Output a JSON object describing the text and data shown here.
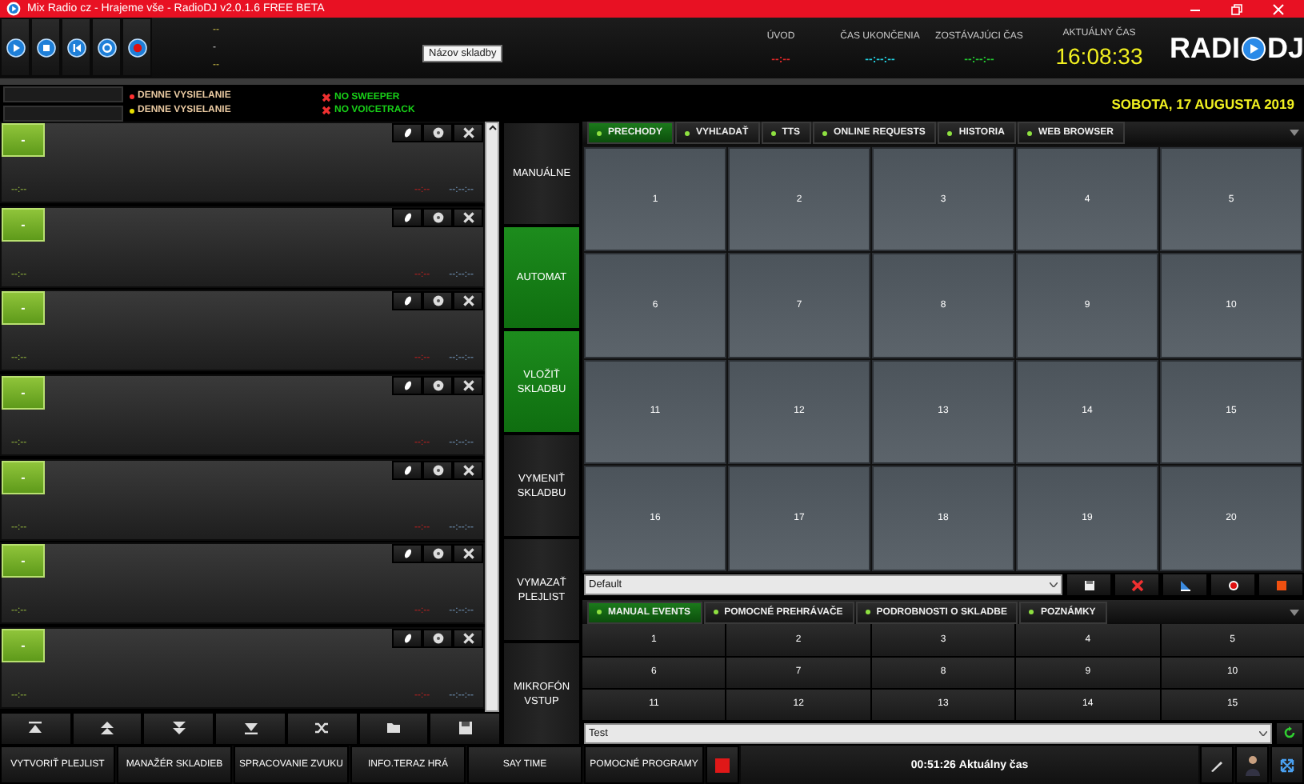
{
  "window": {
    "title": "Mix Radio cz - Hrajeme vše - RadioDJ v2.0.1.6 FREE BETA"
  },
  "header": {
    "track_lines": [
      "--",
      "-",
      "--"
    ],
    "tooltip": "Názov skladby",
    "timers": [
      {
        "label": "ÚVOD",
        "value": "--:--",
        "color": "#e02828"
      },
      {
        "label": "ČAS UKONČENIA",
        "value": "--:--:--",
        "color": "#22d0e0"
      },
      {
        "label": "ZOSTÁVAJÚCI ČAS",
        "value": "--:--:--",
        "color": "#22c830"
      }
    ],
    "clock_label": "AKTUÁLNY ČAS",
    "clock": "16:08:33",
    "logo": [
      "RADI",
      "DJ"
    ]
  },
  "status": {
    "schedules": [
      {
        "label": "DENNE VYSIELANIE",
        "color": "#ff3030"
      },
      {
        "label": "DENNE VYSIELANIE",
        "color": "#e8e000"
      }
    ],
    "warnings": [
      "NO SWEEPER",
      "NO VOICETRACK"
    ],
    "date": "SOBOTA, 17 AUGUSTA 2019"
  },
  "players": [
    {
      "button": "-",
      "elapsed": "--:--",
      "remaining": "--:--",
      "total": "--:--:--"
    },
    {
      "button": "-",
      "elapsed": "--:--",
      "remaining": "--:--",
      "total": "--:--:--"
    },
    {
      "button": "-",
      "elapsed": "--:--",
      "remaining": "--:--",
      "total": "--:--:--"
    },
    {
      "button": "-",
      "elapsed": "--:--",
      "remaining": "--:--",
      "total": "--:--:--"
    },
    {
      "button": "-",
      "elapsed": "--:--",
      "remaining": "--:--",
      "total": "--:--:--"
    },
    {
      "button": "-",
      "elapsed": "--:--",
      "remaining": "--:--",
      "total": "--:--:--"
    },
    {
      "button": "-",
      "elapsed": "--:--",
      "remaining": "--:--",
      "total": "--:--:--"
    }
  ],
  "modes": [
    {
      "label": "MANUÁLNE",
      "on": false
    },
    {
      "label": "AUTOMAT",
      "on": true
    },
    {
      "label": "VLOŽIŤ SKLADBU",
      "on": true
    },
    {
      "label": "VYMENIŤ SKLADBU",
      "on": false
    },
    {
      "label": "VYMAZAŤ PLEJLIST",
      "on": false
    },
    {
      "label": "MIKROFÓN VSTUP",
      "on": false
    }
  ],
  "tabs": [
    {
      "label": "PRECHODY",
      "selected": true
    },
    {
      "label": "VYHĽADAŤ",
      "selected": false
    },
    {
      "label": "TTS",
      "selected": false
    },
    {
      "label": "ONLINE REQUESTS",
      "selected": false
    },
    {
      "label": "HISTORIA",
      "selected": false
    },
    {
      "label": "WEB BROWSER",
      "selected": false
    }
  ],
  "pads": [
    "1",
    "2",
    "3",
    "4",
    "5",
    "6",
    "7",
    "8",
    "9",
    "10",
    "11",
    "12",
    "13",
    "14",
    "15",
    "16",
    "17",
    "18",
    "19",
    "20"
  ],
  "pad_set": {
    "value": "Default"
  },
  "bottom_tabs": [
    {
      "label": "MANUAL EVENTS",
      "selected": true
    },
    {
      "label": "POMOCNÉ PREHRÁVAČE",
      "selected": false
    },
    {
      "label": "PODROBNOSTI O SKLADBE",
      "selected": false
    },
    {
      "label": "POZNÁMKY",
      "selected": false
    }
  ],
  "events": [
    "1",
    "2",
    "3",
    "4",
    "5",
    "6",
    "7",
    "8",
    "9",
    "10",
    "11",
    "12",
    "13",
    "14",
    "15"
  ],
  "event_set": {
    "value": "Test"
  },
  "footer": {
    "buttons": [
      "VYTVORIŤ PLEJLIST",
      "MANAŽÉR SKLADIEB",
      "SPRACOVANIE ZVUKU",
      "INFO.TERAZ HRÁ",
      "SAY TIME",
      "POMOCNÉ PROGRAMY"
    ],
    "clock": "00:51:26",
    "clock_label": "Aktuálny čas"
  }
}
